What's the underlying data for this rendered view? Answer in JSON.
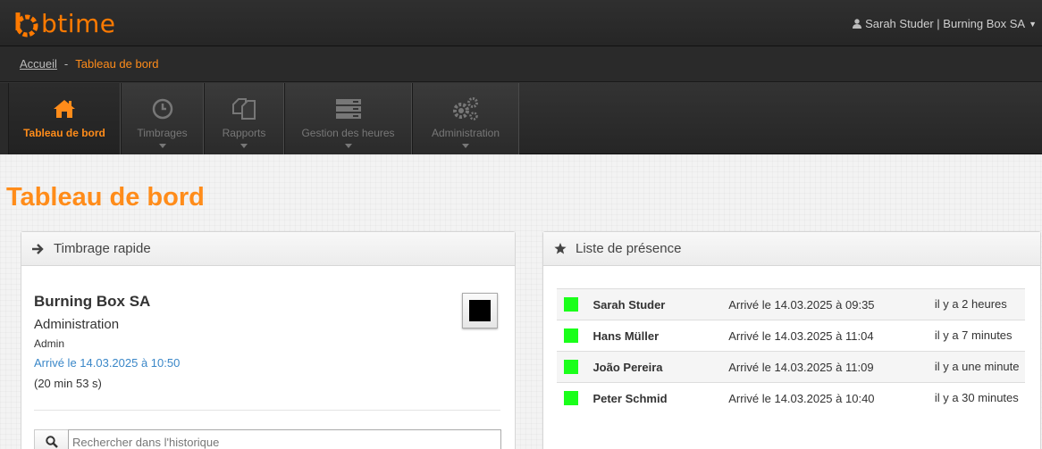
{
  "app": {
    "logo_text": "btime",
    "brand_color": "#ff7a00"
  },
  "user_menu": {
    "label": "Sarah Studer | Burning Box SA"
  },
  "breadcrumb": {
    "home": "Accueil",
    "separator": "-",
    "current": "Tableau de bord"
  },
  "nav": [
    {
      "label": "Tableau de bord",
      "icon": "home-icon",
      "active": true
    },
    {
      "label": "Timbrages",
      "icon": "clock-icon",
      "active": false
    },
    {
      "label": "Rapports",
      "icon": "documents-icon",
      "active": false
    },
    {
      "label": "Gestion des heures",
      "icon": "server-icon",
      "active": false
    },
    {
      "label": "Administration",
      "icon": "gears-icon",
      "active": false
    }
  ],
  "page_title": "Tableau de bord",
  "quick_stamp": {
    "title": "Timbrage rapide",
    "company": "Burning Box SA",
    "department": "Administration",
    "role": "Admin",
    "arrived": "Arrivé le 14.03.2025 à 10:50",
    "duration": "(20 min 53 s)",
    "search_placeholder": "Rechercher dans l'historique"
  },
  "presence": {
    "title": "Liste de présence",
    "status_color": "#1aff1a",
    "rows": [
      {
        "name": "Sarah Studer",
        "arrived": "Arrivé le 14.03.2025 à 09:35",
        "ago": "il y a 2 heures"
      },
      {
        "name": "Hans Müller",
        "arrived": "Arrivé le 14.03.2025 à 11:04",
        "ago": "il y a 7 minutes"
      },
      {
        "name": "João Pereira",
        "arrived": "Arrivé le 14.03.2025 à 11:09",
        "ago": "il y a une minute"
      },
      {
        "name": "Peter Schmid",
        "arrived": "Arrivé le 14.03.2025 à 10:40",
        "ago": "il y a 30 minutes"
      }
    ]
  }
}
